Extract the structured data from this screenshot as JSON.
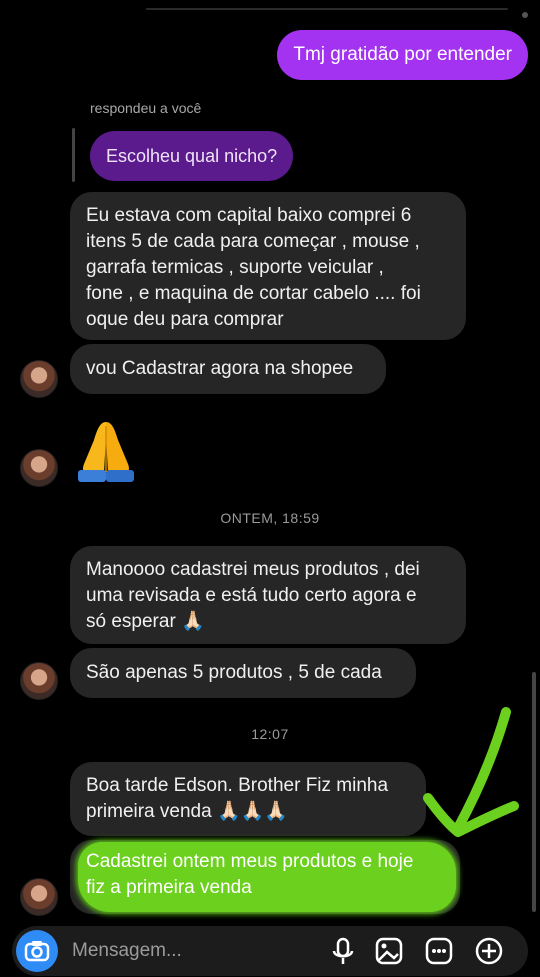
{
  "thread": {
    "sent_message": "Tmj gratidão por entender",
    "reply_meta": "respondeu a você",
    "reply_quote": "Escolheu qual nicho?",
    "messages": [
      "Eu estava com capital baixo comprei 6\nitens 5 de cada para começar , mouse ,\ngarrafa termicas , suporte veicular ,\nfone , e maquina de cortar cabelo .... foi\noque deu para comprar",
      "vou Cadastrar agora na shopee",
      "Manoooo cadastrei meus produtos , dei\numa revisada e está tudo certo agora e\nsó esperar 🙏🏻",
      "São apenas 5 produtos , 5 de cada",
      "Boa tarde Edson. Brother Fiz minha\nprimeira venda 🙏🏻🙏🏻🙏🏻",
      "Cadastrei ontem meus produtos e hoje\nfiz a primeira venda"
    ],
    "timestamps": [
      "ONTEM, 18:59",
      "12:07"
    ],
    "big_emoji": "🙏"
  },
  "composer": {
    "placeholder": "Mensagem...",
    "icons": [
      "camera-icon",
      "microphone-icon",
      "image-icon",
      "sticker-icon",
      "add-icon"
    ]
  },
  "colors": {
    "background": "#000000",
    "incoming_bubble": "#262626",
    "outgoing_bubble": "#a333f0",
    "reply_bubble": "#5c1b8c",
    "highlight_marker": "#6cd01f",
    "accent_blue": "#2f8cf7"
  }
}
